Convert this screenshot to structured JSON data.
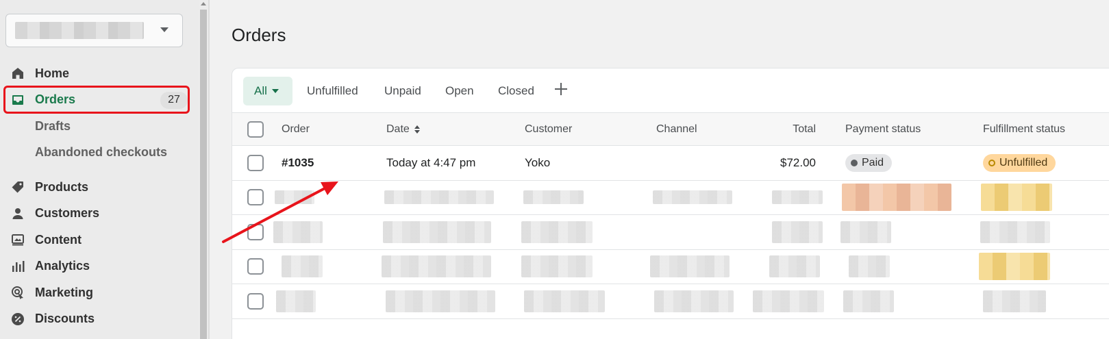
{
  "sidebar": {
    "nav": [
      {
        "label": "Home",
        "icon": "home-icon"
      },
      {
        "label": "Orders",
        "icon": "inbox-icon",
        "badge": "27",
        "active": true
      },
      {
        "label": "Drafts"
      },
      {
        "label": "Abandoned checkouts"
      },
      {
        "label": "Products",
        "icon": "tag-icon"
      },
      {
        "label": "Customers",
        "icon": "person-icon"
      },
      {
        "label": "Content",
        "icon": "content-icon"
      },
      {
        "label": "Analytics",
        "icon": "bar-chart-icon"
      },
      {
        "label": "Marketing",
        "icon": "target-icon"
      },
      {
        "label": "Discounts",
        "icon": "discount-icon"
      }
    ]
  },
  "page": {
    "title": "Orders"
  },
  "tabs": {
    "all": "All",
    "unfulfilled": "Unfulfilled",
    "unpaid": "Unpaid",
    "open": "Open",
    "closed": "Closed"
  },
  "table": {
    "headers": {
      "order": "Order",
      "date": "Date",
      "customer": "Customer",
      "channel": "Channel",
      "total": "Total",
      "payment": "Payment status",
      "fulfillment": "Fulfillment status"
    },
    "rows": [
      {
        "order": "#1035",
        "date": "Today at 4:47 pm",
        "customer": "Yoko",
        "channel": "",
        "total": "$72.00",
        "payment": "Paid",
        "fulfillment": "Unfulfilled"
      }
    ]
  },
  "colors": {
    "accent_green": "#1a7a4c",
    "highlight_red": "#e8141b",
    "arrow_red": "#e8141b"
  }
}
